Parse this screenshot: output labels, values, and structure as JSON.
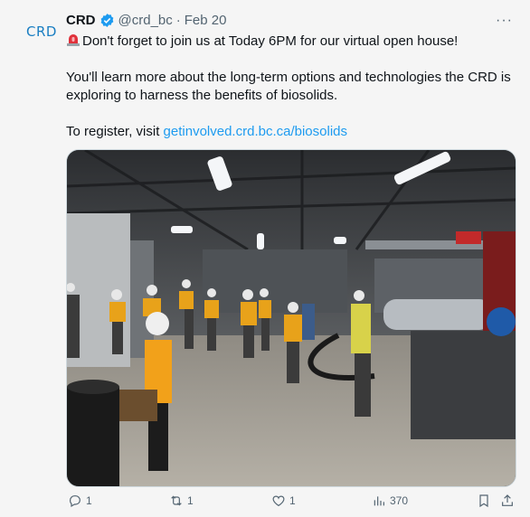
{
  "tweet": {
    "avatar_text": "CRD",
    "display_name": "CRD",
    "handle": "@crd_bc",
    "separator": "·",
    "date": "Feb 20",
    "more_icon": "ellipsis-icon",
    "line1": "Don't forget to join us at Today 6PM for our virtual open house!",
    "line2": "You'll learn more about the long-term options and technologies the CRD is",
    "line3": "exploring to harness the benefits of biosolids.",
    "register_prefix": "To register, visit ",
    "link_text": "getinvolved.crd.bc.ca/biosolids",
    "accent_color": "#1d9bf0"
  },
  "actions": {
    "replies": "1",
    "retweets": "1",
    "likes": "1",
    "views": "370"
  }
}
